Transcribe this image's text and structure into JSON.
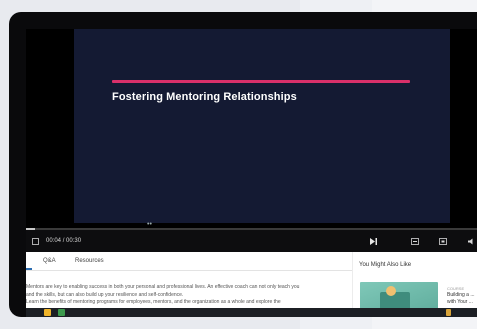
{
  "slide": {
    "title": "Fostering Mentoring Relationships"
  },
  "player": {
    "current_time": "00:04",
    "separator": "/",
    "duration": "00:30",
    "progress_fraction": 0.02
  },
  "tabs": [
    {
      "label": "Q&A"
    },
    {
      "label": "Resources"
    }
  ],
  "description": {
    "lines": [
      "Mentors are key to enabling success in both your personal and professional lives. An effective coach can not only teach you",
      "and the skills, but can also build up your resilience and self-confidence.",
      "Learn the benefits of mentoring programs for employees, mentors, and the organization as a whole and explore the"
    ]
  },
  "sidebar": {
    "title": "You Might Also Like",
    "card": {
      "label": "COURSE",
      "title": "Building a ... with Your ..."
    }
  },
  "colors": {
    "slide_background": "#141a33",
    "accent_bar": "#d9306a",
    "tab_indicator": "#2b6cb0"
  }
}
